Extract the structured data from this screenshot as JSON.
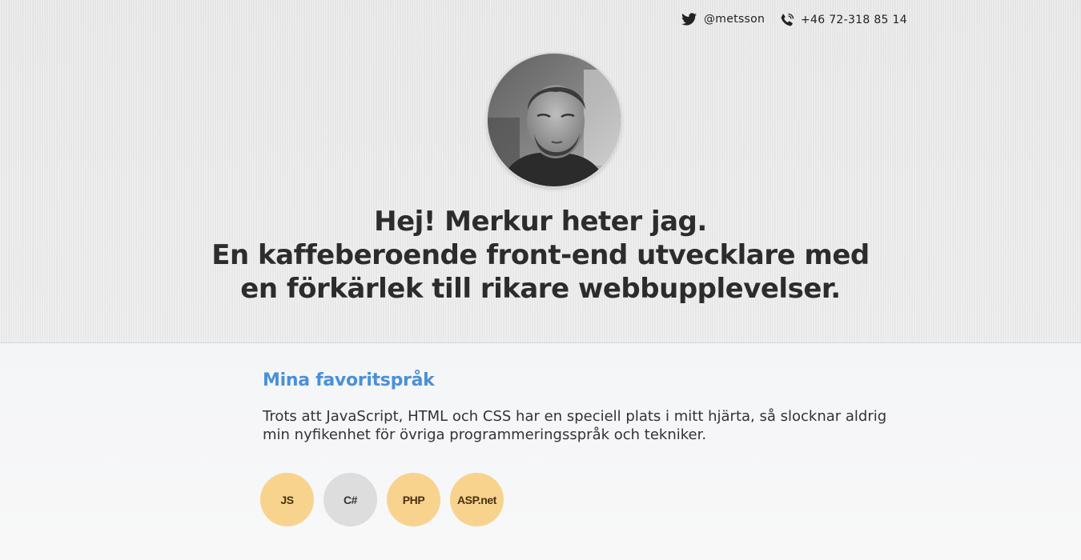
{
  "header": {
    "twitter": {
      "handle": "@metsson",
      "icon": "twitter-bird-icon"
    },
    "phone": {
      "number": "+46 72-318 85 14",
      "icon": "phone-icon"
    }
  },
  "avatar": {
    "icon": "profile-photo"
  },
  "headline": {
    "line1": "Hej! Merkur heter jag.",
    "line2": "En kaffeberoende front-end utvecklare med",
    "line3": "en förkärlek till rikare webbupplevelser."
  },
  "favorites": {
    "title": "Mina favoritspråk",
    "text": "Trots att JavaScript, HTML och CSS har en speciell plats i mitt hjärta, så slocknar aldrig min nyfikenhet för övriga programmeringsspråk och tekniker.",
    "skills": [
      {
        "label": "JS",
        "color": "#f8d38e"
      },
      {
        "label": "C#",
        "color": "#dddddd"
      },
      {
        "label": "PHP",
        "color": "#f8d38e"
      },
      {
        "label": "ASP.net",
        "color": "#f8d38e"
      }
    ]
  },
  "colors": {
    "accent": "#4a90d9",
    "heading": "#2c2c2c",
    "hero_bg": "#ebebeb",
    "content_bg": "#f5f6f8"
  }
}
